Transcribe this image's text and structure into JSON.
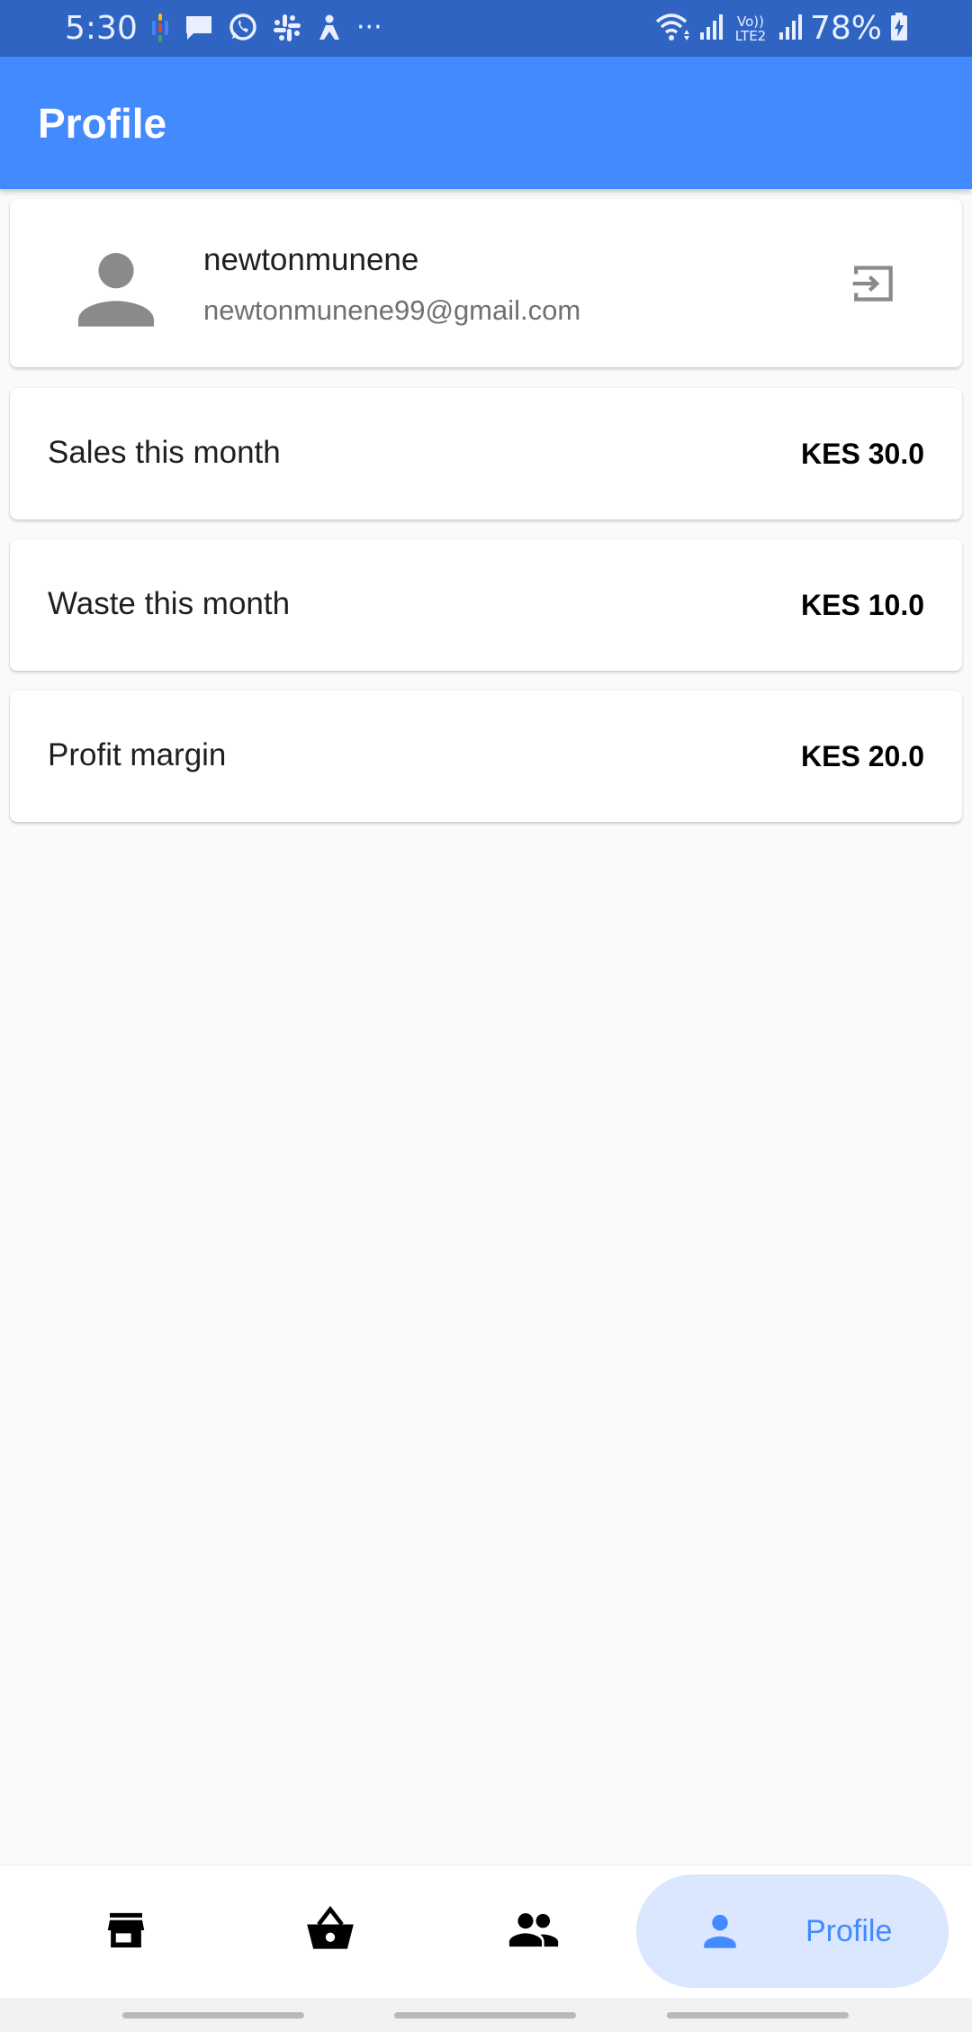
{
  "status_bar": {
    "time": "5:30",
    "battery_percent": "78%",
    "notification_icons": [
      "google-podcasts-icon",
      "message-icon",
      "whatsapp-icon",
      "slack-icon",
      "app-icon",
      "more-dots-icon"
    ],
    "right_icons": [
      "wifi-icon",
      "signal-icon",
      "volte-lte2-icon",
      "signal-icon",
      "battery-charging-icon"
    ],
    "more_dots": "···",
    "volte_label": "Vo)) LTE2"
  },
  "app_bar": {
    "title": "Profile"
  },
  "profile_card": {
    "avatar_icon": "person-icon",
    "name": "newtonmunene",
    "email": "newtonmunene99@gmail.com",
    "logout_icon": "exit-to-app-icon"
  },
  "stats": [
    {
      "label": "Sales this month",
      "value": "KES 30.0"
    },
    {
      "label": "Waste this month",
      "value": "KES 10.0"
    },
    {
      "label": "Profit margin",
      "value": "KES 20.0"
    }
  ],
  "bottom_nav": {
    "items": [
      {
        "icon": "store-icon",
        "label": ""
      },
      {
        "icon": "basket-icon",
        "label": ""
      },
      {
        "icon": "people-icon",
        "label": ""
      },
      {
        "icon": "person-icon",
        "label": "Profile",
        "selected": true
      }
    ]
  },
  "colors": {
    "status_bar": "#2f64c2",
    "app_bar": "#448aff",
    "background": "#fafafa",
    "nav_selected_pill": "#dae7fe",
    "nav_selected_text": "#448aff",
    "icon_grey": "#8a8a8a"
  }
}
